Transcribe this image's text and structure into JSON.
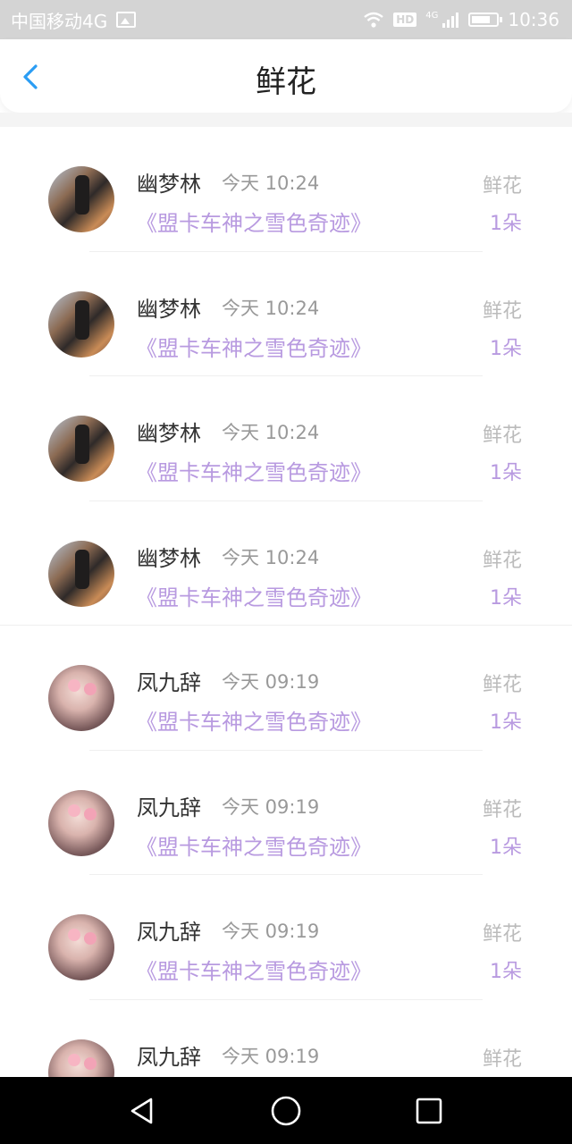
{
  "status_bar": {
    "carrier": "中国移动4G",
    "hd": "HD",
    "network": "4G",
    "time": "10:36"
  },
  "header": {
    "title": "鲜花",
    "back_icon": "chevron-left-icon",
    "accent_color": "#2a9df4"
  },
  "list": {
    "items": [
      {
        "name": "幽梦林",
        "time": "今天 10:24",
        "gift_title": "《盟卡车神之雪色奇迹》",
        "gift_type": "鲜花",
        "count": "1朵",
        "avatar": "a1"
      },
      {
        "name": "幽梦林",
        "time": "今天 10:24",
        "gift_title": "《盟卡车神之雪色奇迹》",
        "gift_type": "鲜花",
        "count": "1朵",
        "avatar": "a1"
      },
      {
        "name": "幽梦林",
        "time": "今天 10:24",
        "gift_title": "《盟卡车神之雪色奇迹》",
        "gift_type": "鲜花",
        "count": "1朵",
        "avatar": "a1"
      },
      {
        "name": "幽梦林",
        "time": "今天 10:24",
        "gift_title": "《盟卡车神之雪色奇迹》",
        "gift_type": "鲜花",
        "count": "1朵",
        "avatar": "a1"
      },
      {
        "name": "凤九辞",
        "time": "今天 09:19",
        "gift_title": "《盟卡车神之雪色奇迹》",
        "gift_type": "鲜花",
        "count": "1朵",
        "avatar": "a2"
      },
      {
        "name": "凤九辞",
        "time": "今天 09:19",
        "gift_title": "《盟卡车神之雪色奇迹》",
        "gift_type": "鲜花",
        "count": "1朵",
        "avatar": "a2"
      },
      {
        "name": "凤九辞",
        "time": "今天 09:19",
        "gift_title": "《盟卡车神之雪色奇迹》",
        "gift_type": "鲜花",
        "count": "1朵",
        "avatar": "a2"
      },
      {
        "name": "凤九辞",
        "time": "今天 09:19",
        "gift_title": "",
        "gift_type": "鲜花",
        "count": "",
        "avatar": "a2"
      }
    ],
    "accent_color": "#b89ae0"
  },
  "navbar": {
    "back_icon": "triangle-back-icon",
    "home_icon": "circle-home-icon",
    "recent_icon": "square-recents-icon"
  }
}
